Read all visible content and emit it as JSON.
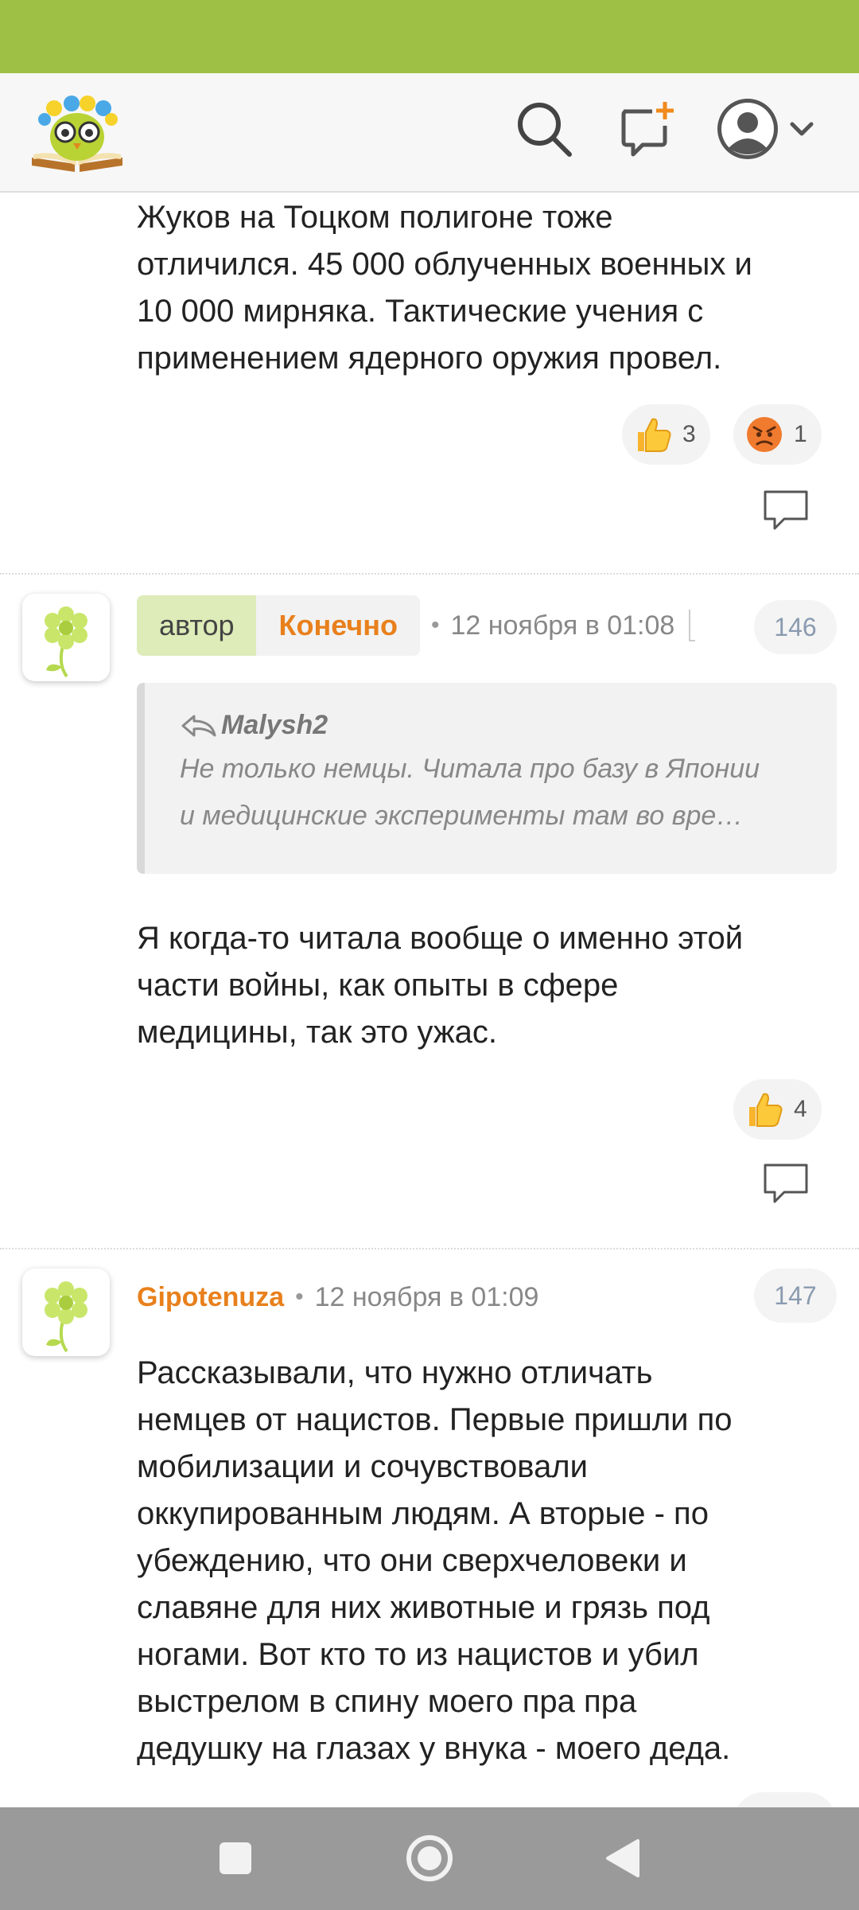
{
  "colors": {
    "status_bar": "#9ec044",
    "accent_orange": "#e8801c",
    "author_green": "#ddecb8",
    "nav_bar": "#9a9a9a"
  },
  "header": {
    "logo_icon": "owl-reading-book-logo",
    "search_icon": "search-icon",
    "new_post_icon": "new-message-plus-icon",
    "profile_icon": "user-avatar-icon",
    "menu_icon": "chevron-down-icon"
  },
  "comments": [
    {
      "text_lines": [
        "Жуков на Тоцком полигоне тоже",
        "отличился. 45 000 облученных военных и",
        "10 000 мирняка. Тактические учения с",
        "применением ядерного оружия провел."
      ],
      "reactions": [
        {
          "emoji": "thumbs-up-icon",
          "count": "3"
        },
        {
          "emoji": "angry-face-icon",
          "count": "1"
        }
      ]
    },
    {
      "role_label": "автор",
      "username": "Конечно",
      "time": "12 ноября в 01:08",
      "number": "146",
      "quote": {
        "author": "Malysh2",
        "lines": [
          "Не только немцы. Читала про базу в Японии",
          "и медицинские эксперименты там во вре…"
        ]
      },
      "text_lines": [
        "Я когда-то читала вообще о именно этой",
        "части войны, как опыты в сфере",
        "медицины, так это ужас."
      ],
      "reactions": [
        {
          "emoji": "thumbs-up-icon",
          "count": "4"
        }
      ]
    },
    {
      "username": "Gipotenuza",
      "time": "12 ноября в 01:09",
      "number": "147",
      "text_lines": [
        "Рассказывали, что нужно отличать",
        "немцев от нацистов. Первые пришли по",
        "мобилизации и сочувствовали",
        "оккупированным людям. А вторые - по",
        "убеждению, что они сверхчеловеки и",
        "славяне для них животные и грязь под",
        "ногами. Вот кто то из нацистов и убил",
        "выстрелом в спину моего пра пра",
        "дедушку на глазах у внука - моего деда."
      ]
    }
  ],
  "nav": {
    "recent_icon": "square-recents-icon",
    "home_icon": "circle-home-icon",
    "back_icon": "triangle-back-icon"
  }
}
